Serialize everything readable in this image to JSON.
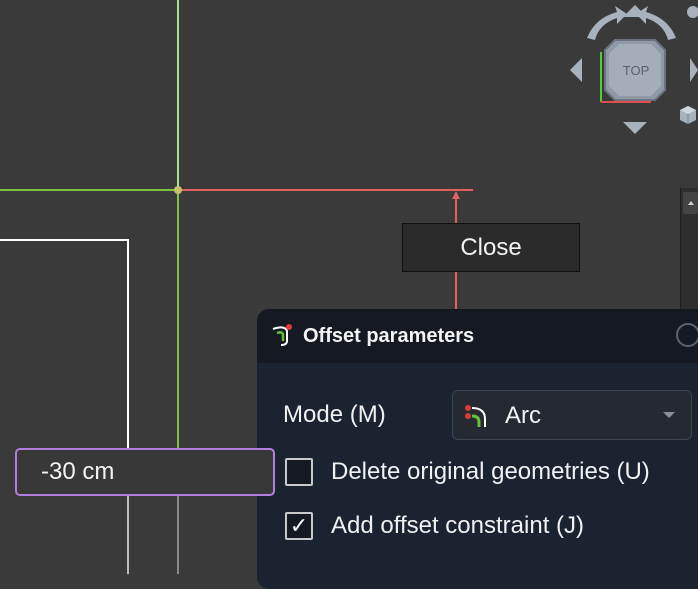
{
  "navigation_cube": {
    "face_label": "TOP",
    "icons": [
      "rotate-left-arrow-icon",
      "rotate-right-arrow-icon",
      "arrow-up-icon",
      "arrow-down-icon",
      "arrow-left-icon",
      "arrow-right-icon",
      "view-menu-cube-icon"
    ]
  },
  "close_button": {
    "label": "Close"
  },
  "dimension_input": {
    "value": "-30 cm"
  },
  "offset_panel": {
    "title": "Offset parameters",
    "icon": "offset-tool-icon",
    "mode": {
      "label": "Mode (M)",
      "value": "Arc",
      "icon": "arc-mode-icon"
    },
    "options": [
      {
        "label": "Delete original geometries (U)",
        "checked": false
      },
      {
        "label": "Add offset constraint (J)",
        "checked": true
      }
    ],
    "check_mark": "✓"
  },
  "colors": {
    "background": "#3a3a3a",
    "x_axis": "#e06060",
    "y_axis": "#7fd34a",
    "input_accent": "#b27fe0",
    "panel_bg": "#1b2230"
  }
}
